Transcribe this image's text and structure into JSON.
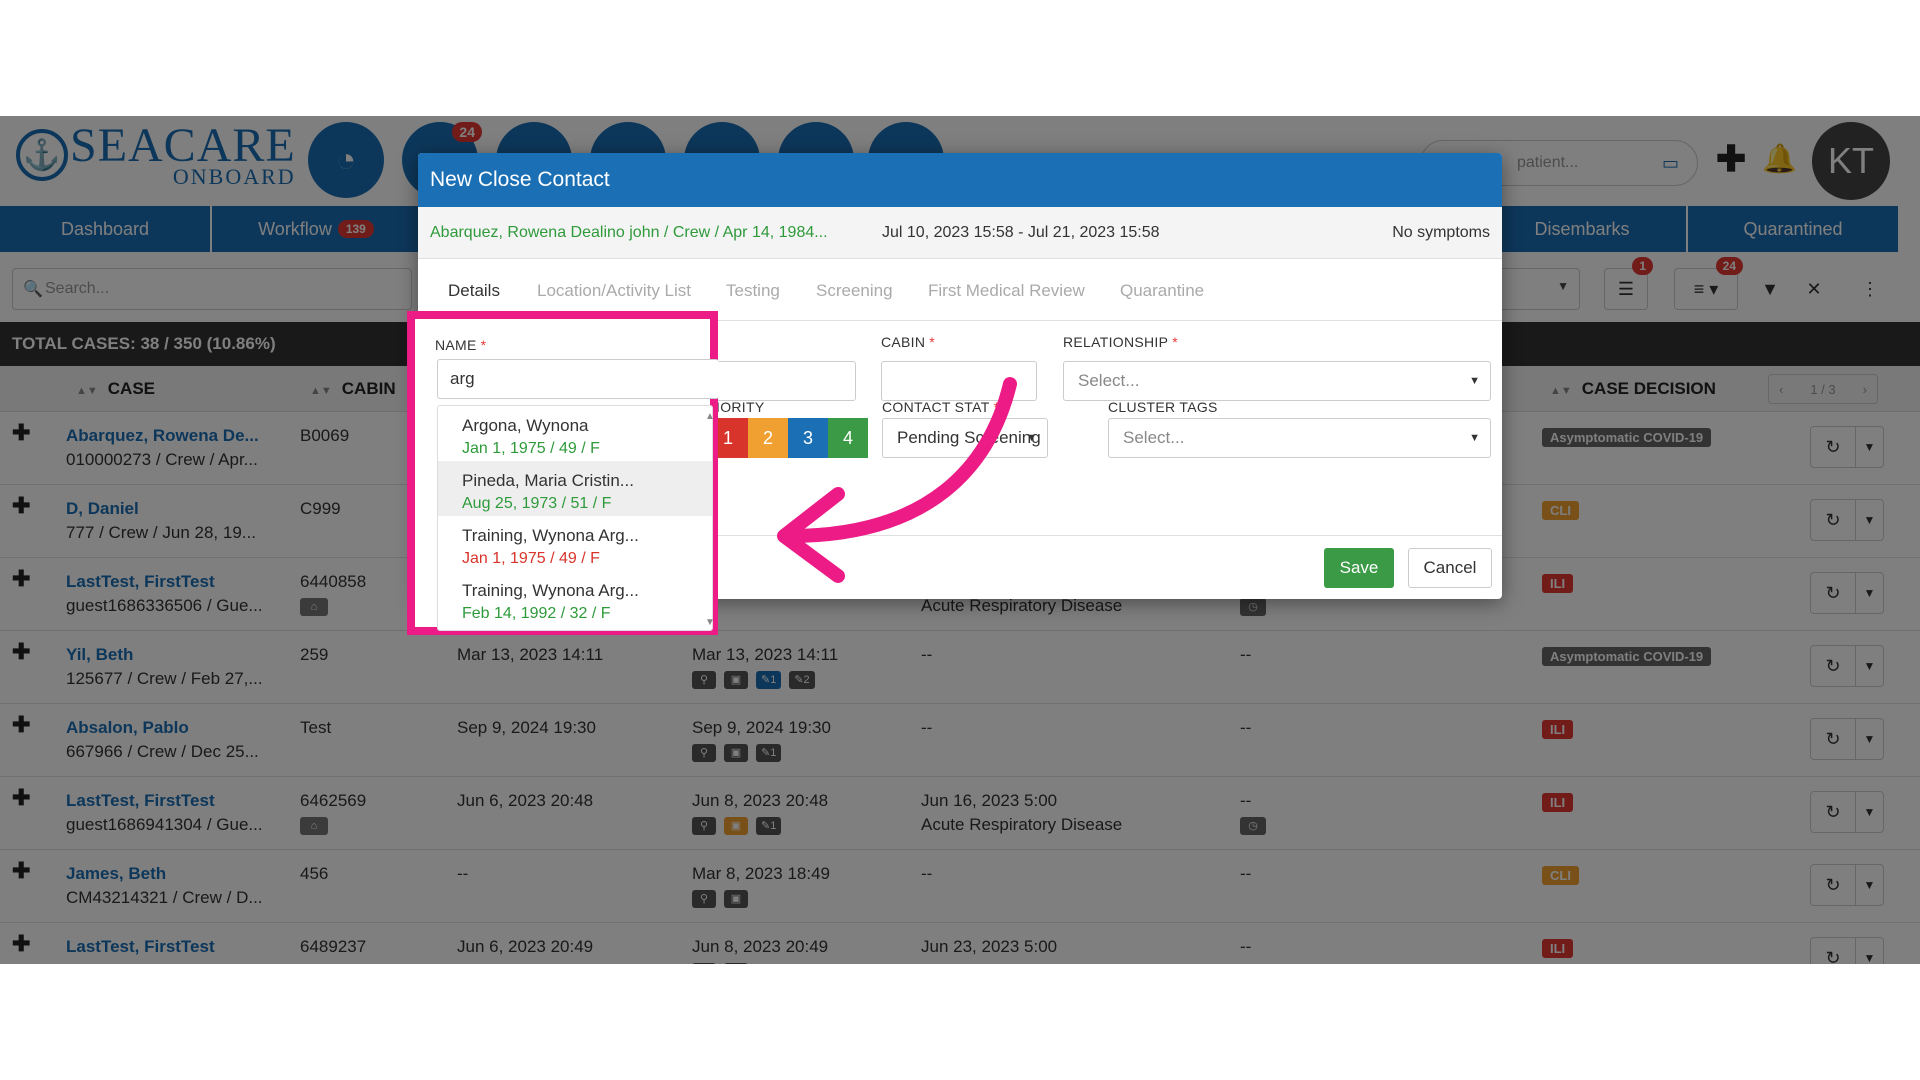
{
  "app": {
    "logo_main": "SEACARE",
    "logo_sub": "ONBOARD",
    "workflow_badge": "24",
    "search_placeholder": "patient...",
    "avatar_initials": "KT"
  },
  "nav": {
    "tabs": [
      "Dashboard",
      "Workflow",
      "Disembarks",
      "Quarantined"
    ],
    "workflow_count": "139"
  },
  "filter": {
    "search_placeholder": "Search...",
    "filter_badge": "1",
    "columns_badge": "24"
  },
  "summary": {
    "total_cases": "TOTAL CASES: 38 / 350 (10.86%)"
  },
  "table": {
    "headers": {
      "case": "CASE",
      "cabin": "CABIN",
      "case_decision": "CASE DECISION"
    },
    "pager": "1 / 3",
    "rows": [
      {
        "name": "Abarquez, Rowena De...",
        "sub": "010000273 / Crew / Apr...",
        "cabin": "B0069",
        "date1": "",
        "date2": "",
        "d3": "",
        "d3b": "",
        "d4": "",
        "decision": "Asymptomatic COVID-19",
        "dec": "asym"
      },
      {
        "name": "D, Daniel",
        "sub": "777 / Crew / Jun 28, 19...",
        "cabin": "C999",
        "date1": "",
        "date2": "",
        "d3": "",
        "d3b": "",
        "d4": "",
        "decision": "CLI",
        "dec": "cli"
      },
      {
        "name": "LastTest, FirstTest",
        "sub": "guest1686336506 / Gue...",
        "cabin": "6440858",
        "date1": "",
        "date2": "",
        "d3": "",
        "d3b": "Acute Respiratory Disease",
        "d4": "",
        "decision": "ILI",
        "dec": "ili"
      },
      {
        "name": "Yil, Beth",
        "sub": "125677 / Crew / Feb 27,...",
        "cabin": "259",
        "date1": "Mar 13, 2023 14:11",
        "date2": "Mar 13, 2023 14:11",
        "d3": "--",
        "d3b": "",
        "d4": "--",
        "decision": "Asymptomatic COVID-19",
        "dec": "asym"
      },
      {
        "name": "Absalon, Pablo",
        "sub": "667966 / Crew / Dec 25...",
        "cabin": "Test",
        "date1": "Sep 9, 2024 19:30",
        "date2": "Sep 9, 2024 19:30",
        "d3": "--",
        "d3b": "",
        "d4": "--",
        "decision": "ILI",
        "dec": "ili"
      },
      {
        "name": "LastTest, FirstTest",
        "sub": "guest1686941304 / Gue...",
        "cabin": "6462569",
        "date1": "Jun 6, 2023 20:48",
        "date2": "Jun 8, 2023 20:48",
        "d3": "Jun 16, 2023 5:00",
        "d3b": "Acute Respiratory Disease",
        "d4": "--",
        "decision": "ILI",
        "dec": "ili"
      },
      {
        "name": "James, Beth",
        "sub": "CM43214321 / Crew / D...",
        "cabin": "456",
        "date1": "--",
        "date2": "Mar 8, 2023 18:49",
        "d3": "--",
        "d3b": "",
        "d4": "--",
        "decision": "CLI",
        "dec": "cli"
      },
      {
        "name": "LastTest, FirstTest",
        "sub": "",
        "cabin": "6489237",
        "date1": "Jun 6, 2023 20:49",
        "date2": "Jun 8, 2023 20:49",
        "d3": "Jun 23, 2023 5:00",
        "d3b": "",
        "d4": "--",
        "decision": "ILI",
        "dec": "ili"
      }
    ]
  },
  "modal": {
    "title": "New Close Contact",
    "patient": "Abarquez, Rowena Dealino john / Crew / Apr 14, 1984...",
    "period": "Jul 10, 2023 15:58 - Jul 21, 2023 15:58",
    "symptoms": "No symptoms",
    "tabs": [
      "Details",
      "Location/Activity List",
      "Testing",
      "Screening",
      "First Medical Review",
      "Quarantine"
    ],
    "fields": {
      "name_label": "NAME",
      "name_value": "arg",
      "cabin_label": "CABIN",
      "relationship_label": "RELATIONSHIP",
      "relationship_placeholder": "Select...",
      "priority_label": "IORITY",
      "contact_status_label": "CONTACT STAT",
      "contact_status_value": "Pending Screening",
      "cluster_tags_label": "CLUSTER TAGS",
      "cluster_tags_placeholder": "Select..."
    },
    "priority_options": [
      "1",
      "2",
      "3",
      "4"
    ],
    "save_label": "Save",
    "cancel_label": "Cancel"
  },
  "autocomplete": [
    {
      "name": "Argona, Wynona",
      "meta": "Jan 1, 1975 / 49 / F",
      "meta_color": "green"
    },
    {
      "name": "Pineda, Maria Cristin...",
      "meta": "Aug 25, 1973 / 51 / F",
      "meta_color": "green"
    },
    {
      "name": "Training, Wynona Arg...",
      "meta": "Jan 1, 1975 / 49 / F",
      "meta_color": "red"
    },
    {
      "name": "Training, Wynona Arg...",
      "meta": "Feb 14, 1992 / 32 / F",
      "meta_color": "green"
    }
  ],
  "colors": {
    "brand": "#1a6fb5",
    "highlight": "#ec1b86",
    "save": "#3a9a45",
    "priority": [
      "#d9342b",
      "#f0a030",
      "#1a6fb5",
      "#3a9a45"
    ]
  },
  "icons": [
    "anchor-icon",
    "pie-chart-icon",
    "search-icon",
    "card-icon",
    "plus-icon",
    "bell-icon",
    "sliders-icon",
    "list-icon",
    "filter-icon",
    "close-icon",
    "more-icon",
    "refresh-icon",
    "chevron-down-icon",
    "home-icon",
    "pin-icon",
    "clock-icon"
  ]
}
